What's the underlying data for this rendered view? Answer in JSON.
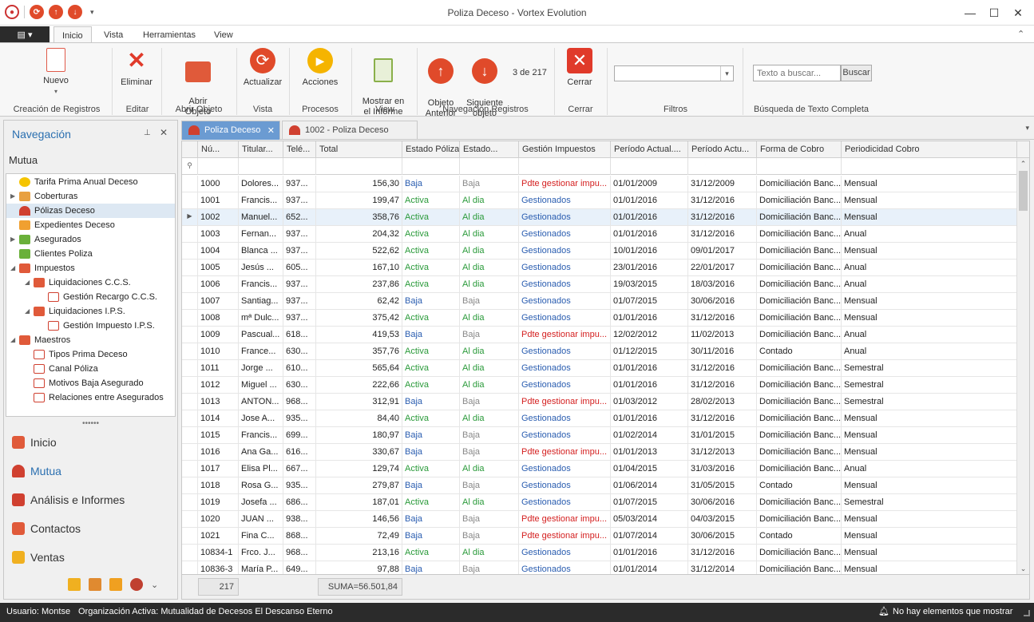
{
  "window": {
    "title": "Poliza Deceso - Vortex Evolution",
    "min": "—",
    "max": "☐",
    "close": "✕"
  },
  "ribbon_tabs": [
    "Inicio",
    "Vista",
    "Herramientas",
    "View"
  ],
  "ribbon": {
    "nuevo": "Nuevo",
    "eliminar": "Eliminar",
    "abrir": "Abrir\nObjeto",
    "actualizar": "Actualizar",
    "acciones": "Acciones",
    "mostrar": "Mostrar en\nel Informe",
    "anterior": "Objeto\nAnterior",
    "siguiente": "Siguiente\nobjeto",
    "counter": "3 de 217",
    "cerrar": "Cerrar",
    "search_placeholder": "Texto a buscar...",
    "buscar": "Buscar",
    "groups": [
      "Creación de Registros",
      "Editar",
      "Abrir Objeto",
      "Vista",
      "Procesos",
      "View",
      "Navegación Registros",
      "Cerrar",
      "Filtros",
      "Búsqueda de Texto Completa"
    ]
  },
  "nav": {
    "title": "Navegación",
    "section": "Mutua",
    "tree": [
      "Tarifa Prima Anual Deceso",
      "Coberturas",
      "Pólizas Deceso",
      "Expedientes Deceso",
      "Asegurados",
      "Clientes Poliza",
      "Impuestos",
      "Liquidaciones C.C.S.",
      "Gestión Recargo C.C.S.",
      "Liquidaciones I.P.S.",
      "Gestión Impuesto I.P.S.",
      "Maestros",
      "Tipos Prima Deceso",
      "Canal Póliza",
      "Motivos Baja Asegurado",
      "Relaciones entre Asegurados"
    ],
    "grip": "••••••",
    "buttons": [
      "Inicio",
      "Mutua",
      "Análisis e Informes",
      "Contactos",
      "Ventas"
    ]
  },
  "doc_tabs": [
    "Poliza Deceso",
    "1002 - Poliza Deceso"
  ],
  "grid": {
    "columns": [
      "Nú...",
      "Titular...",
      "Telé...",
      "Total",
      "Estado Póliza",
      "Estado...",
      "Gestión Impuestos",
      "Período Actual....",
      "Período Actu...",
      "Forma de Cobro",
      "Periodicidad Cobro"
    ],
    "rows": [
      [
        "1000",
        "Dolores...",
        "937...",
        "156,30",
        "Baja",
        "Baja",
        "Pdte gestionar impu...",
        "01/01/2009",
        "31/12/2009",
        "Domiciliación Banc...",
        "Mensual"
      ],
      [
        "1001",
        "Francis...",
        "937...",
        "199,47",
        "Activa",
        "Al dia",
        "Gestionados",
        "01/01/2016",
        "31/12/2016",
        "Domiciliación Banc...",
        "Mensual"
      ],
      [
        "1002",
        "Manuel...",
        "652...",
        "358,76",
        "Activa",
        "Al dia",
        "Gestionados",
        "01/01/2016",
        "31/12/2016",
        "Domiciliación Banc...",
        "Mensual"
      ],
      [
        "1003",
        "Fernan...",
        "937...",
        "204,32",
        "Activa",
        "Al dia",
        "Gestionados",
        "01/01/2016",
        "31/12/2016",
        "Domiciliación Banc...",
        "Anual"
      ],
      [
        "1004",
        "Blanca ...",
        "937...",
        "522,62",
        "Activa",
        "Al dia",
        "Gestionados",
        "10/01/2016",
        "09/01/2017",
        "Domiciliación Banc...",
        "Mensual"
      ],
      [
        "1005",
        "Jesús ...",
        "605...",
        "167,10",
        "Activa",
        "Al dia",
        "Gestionados",
        "23/01/2016",
        "22/01/2017",
        "Domiciliación Banc...",
        "Anual"
      ],
      [
        "1006",
        "Francis...",
        "937...",
        "237,86",
        "Activa",
        "Al dia",
        "Gestionados",
        "19/03/2015",
        "18/03/2016",
        "Domiciliación Banc...",
        "Anual"
      ],
      [
        "1007",
        "Santiag...",
        "937...",
        "62,42",
        "Baja",
        "Baja",
        "Gestionados",
        "01/07/2015",
        "30/06/2016",
        "Domiciliación Banc...",
        "Mensual"
      ],
      [
        "1008",
        "mª Dulc...",
        "937...",
        "375,42",
        "Activa",
        "Al dia",
        "Gestionados",
        "01/01/2016",
        "31/12/2016",
        "Domiciliación Banc...",
        "Mensual"
      ],
      [
        "1009",
        "Pascual...",
        "618...",
        "419,53",
        "Baja",
        "Baja",
        "Pdte gestionar impu...",
        "12/02/2012",
        "11/02/2013",
        "Domiciliación Banc...",
        "Anual"
      ],
      [
        "1010",
        "France...",
        "630...",
        "357,76",
        "Activa",
        "Al dia",
        "Gestionados",
        "01/12/2015",
        "30/11/2016",
        "Contado",
        "Anual"
      ],
      [
        "1011",
        "Jorge ...",
        "610...",
        "565,64",
        "Activa",
        "Al dia",
        "Gestionados",
        "01/01/2016",
        "31/12/2016",
        "Domiciliación Banc...",
        "Semestral"
      ],
      [
        "1012",
        "Miguel ...",
        "630...",
        "222,66",
        "Activa",
        "Al dia",
        "Gestionados",
        "01/01/2016",
        "31/12/2016",
        "Domiciliación Banc...",
        "Semestral"
      ],
      [
        "1013",
        "ANTON...",
        "968...",
        "312,91",
        "Baja",
        "Baja",
        "Pdte gestionar impu...",
        "01/03/2012",
        "28/02/2013",
        "Domiciliación Banc...",
        "Semestral"
      ],
      [
        "1014",
        "Jose A...",
        "935...",
        "84,40",
        "Activa",
        "Al dia",
        "Gestionados",
        "01/01/2016",
        "31/12/2016",
        "Domiciliación Banc...",
        "Mensual"
      ],
      [
        "1015",
        "Francis...",
        "699...",
        "180,97",
        "Baja",
        "Baja",
        "Gestionados",
        "01/02/2014",
        "31/01/2015",
        "Domiciliación Banc...",
        "Mensual"
      ],
      [
        "1016",
        "Ana Ga...",
        "616...",
        "330,67",
        "Baja",
        "Baja",
        "Pdte gestionar impu...",
        "01/01/2013",
        "31/12/2013",
        "Domiciliación Banc...",
        "Mensual"
      ],
      [
        "1017",
        "Elisa Pl...",
        "667...",
        "129,74",
        "Activa",
        "Al dia",
        "Gestionados",
        "01/04/2015",
        "31/03/2016",
        "Domiciliación Banc...",
        "Anual"
      ],
      [
        "1018",
        "Rosa G...",
        "935...",
        "279,87",
        "Baja",
        "Baja",
        "Gestionados",
        "01/06/2014",
        "31/05/2015",
        "Contado",
        "Mensual"
      ],
      [
        "1019",
        "Josefa ...",
        "686...",
        "187,01",
        "Activa",
        "Al dia",
        "Gestionados",
        "01/07/2015",
        "30/06/2016",
        "Domiciliación Banc...",
        "Semestral"
      ],
      [
        "1020",
        "JUAN ...",
        "938...",
        "146,56",
        "Baja",
        "Baja",
        "Pdte gestionar impu...",
        "05/03/2014",
        "04/03/2015",
        "Domiciliación Banc...",
        "Mensual"
      ],
      [
        "1021",
        "Fina C...",
        "868...",
        "72,49",
        "Baja",
        "Baja",
        "Pdte gestionar impu...",
        "01/07/2014",
        "30/06/2015",
        "Contado",
        "Mensual"
      ],
      [
        "10834-1",
        "Frco. J...",
        "968...",
        "213,16",
        "Activa",
        "Al dia",
        "Gestionados",
        "01/01/2016",
        "31/12/2016",
        "Domiciliación Banc...",
        "Mensual"
      ],
      [
        "10836-3",
        "María P...",
        "649...",
        "97,88",
        "Baja",
        "Baja",
        "Gestionados",
        "01/01/2014",
        "31/12/2014",
        "Domiciliación Banc...",
        "Mensual"
      ]
    ],
    "count": "217",
    "sum": "SUMA=56.501,84"
  },
  "status": {
    "user": "Usuario: Montse",
    "org": "Organización Activa: Mutualidad de Decesos El Descanso Eterno",
    "notif": "No hay elementos que mostrar"
  }
}
